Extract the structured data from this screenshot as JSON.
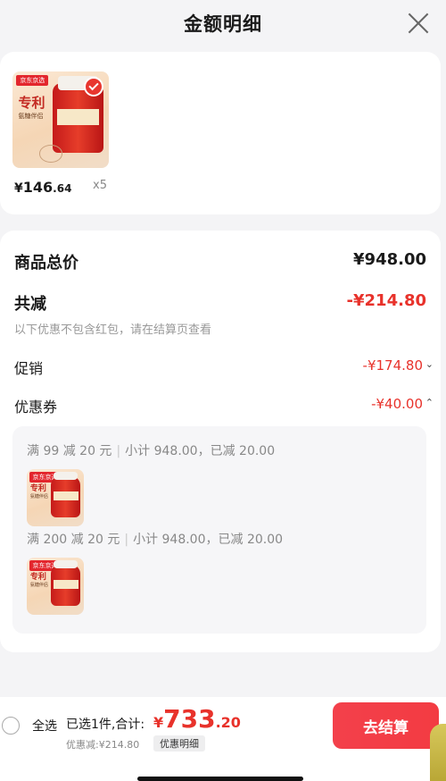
{
  "header": {
    "title": "金额明细"
  },
  "product": {
    "image_tag": "京东京选",
    "image_title": "专利",
    "image_sub": "氨糖伴侣",
    "price_currency": "¥",
    "price_int": "146",
    "price_dec": ".64",
    "quantity": "x5"
  },
  "summary": {
    "total_label": "商品总价",
    "total_value": "¥948.00",
    "reduce_label": "共减",
    "reduce_value": "-¥214.80",
    "note": "以下优惠不包含红包，请在结算页查看",
    "promo_label": "促销",
    "promo_value": "-¥174.80",
    "promo_chevron": "⌄",
    "coupon_label": "优惠券",
    "coupon_value": "-¥40.00",
    "coupon_chevron": "⌃"
  },
  "coupons": [
    {
      "rule": "满 99 减 20 元",
      "sep": "|",
      "detail": "小计 948.00，已减 20.00"
    },
    {
      "rule": "满 200 减 20 元",
      "sep": "|",
      "detail": "小计 948.00，已减 20.00"
    }
  ],
  "bottom": {
    "select_all": "全选",
    "selected_info": "已选1件,合计:",
    "sum_currency": "¥",
    "sum_int": "733",
    "sum_dec": ".20",
    "discount_info": "优惠减:¥214.80",
    "detail_tag": "优惠明细",
    "checkout_label": "去结算"
  },
  "colors": {
    "accent_red": "#e8322b",
    "button_red": "#f33b42"
  }
}
